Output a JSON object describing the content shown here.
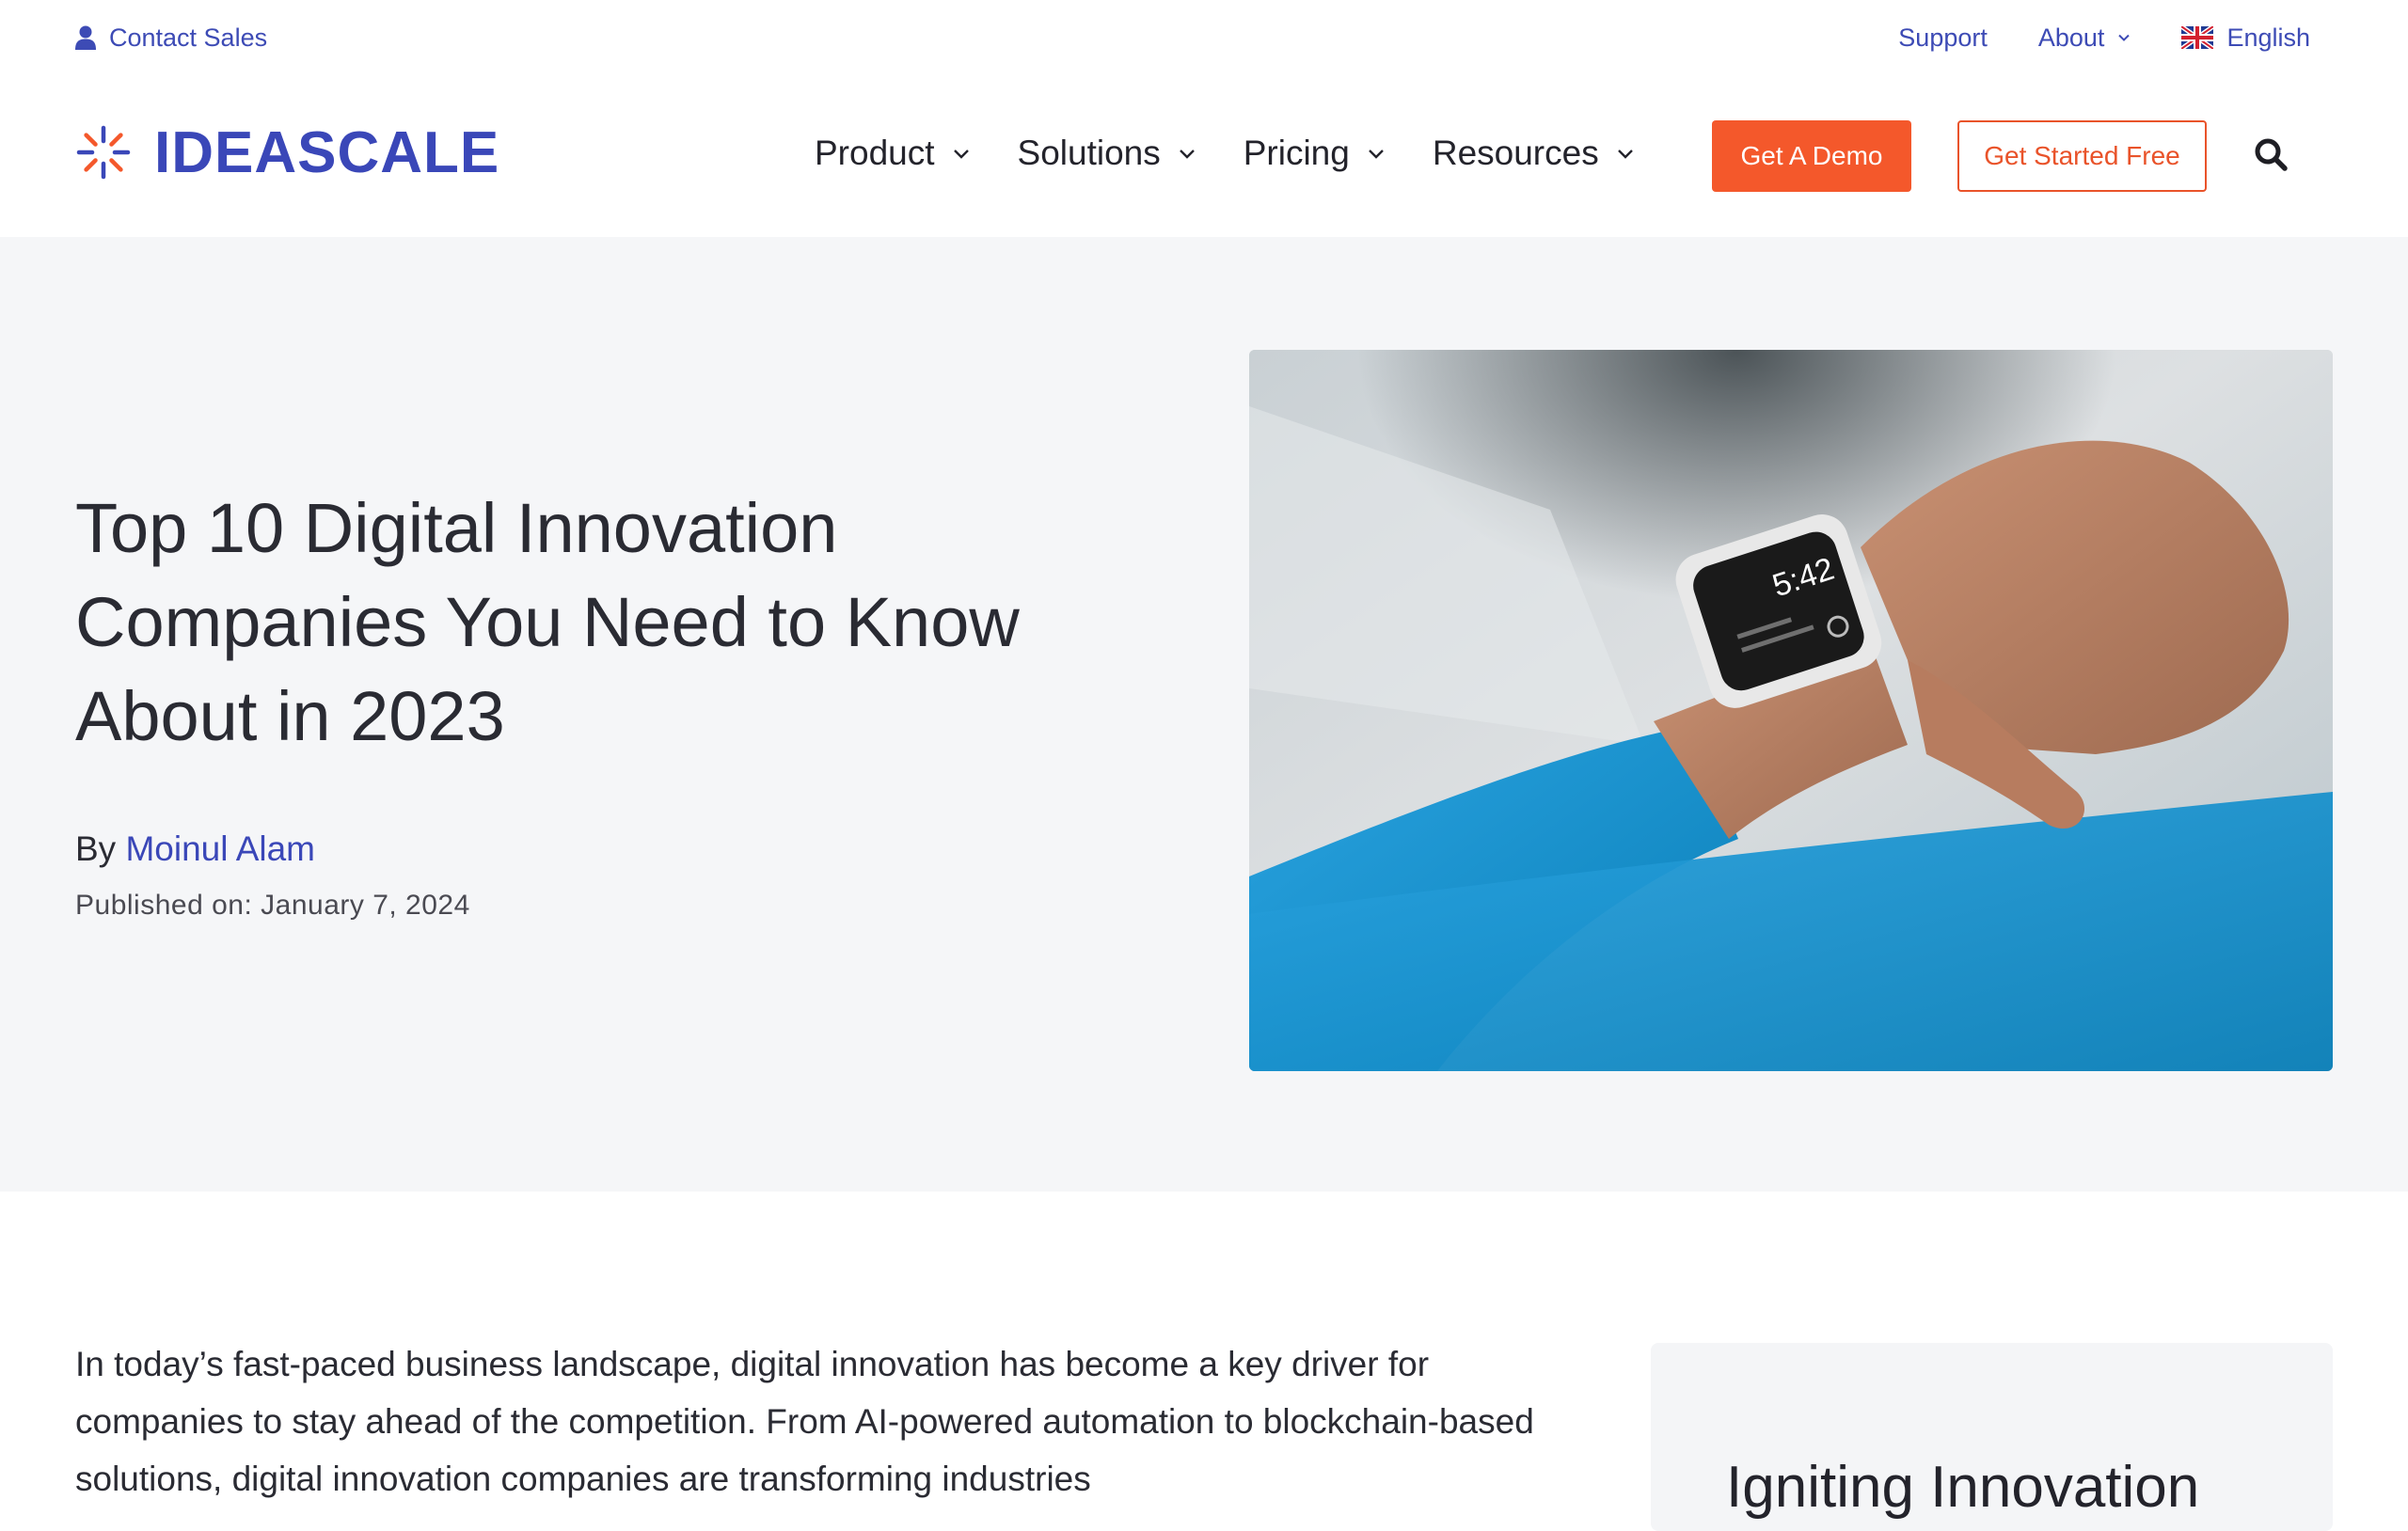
{
  "utility": {
    "contact_sales": "Contact Sales",
    "support": "Support",
    "about": "About",
    "language": "English"
  },
  "header": {
    "logo_text": "IDEASCALE",
    "nav": [
      {
        "label": "Product"
      },
      {
        "label": "Solutions"
      },
      {
        "label": "Pricing"
      },
      {
        "label": "Resources"
      }
    ],
    "demo_button": "Get A Demo",
    "free_button": "Get Started Free"
  },
  "hero": {
    "title": "Top 10 Digital Innovation Companies You Need to Know About in 2023",
    "by_label": "By",
    "author": "Moinul Alam",
    "published": "Published on: January 7, 2024",
    "watch_time": "5:42"
  },
  "article": {
    "intro": "In today’s fast-paced business landscape, digital innovation has become a key driver for companies to stay ahead of the competition. From AI-powered automation to blockchain-based solutions, digital innovation companies are transforming industries"
  },
  "sidebar": {
    "card_title": "Igniting Innovation"
  },
  "colors": {
    "brand_blue": "#3a47b8",
    "link_blue": "#3d4bb5",
    "accent_orange": "#f4582b",
    "hero_bg": "#f5f6f8"
  },
  "icons": {
    "contact": "user-icon",
    "chevron": "chevron-down-icon",
    "flag": "uk-flag-icon",
    "search": "search-icon",
    "logo": "ideascale-logo-icon"
  }
}
